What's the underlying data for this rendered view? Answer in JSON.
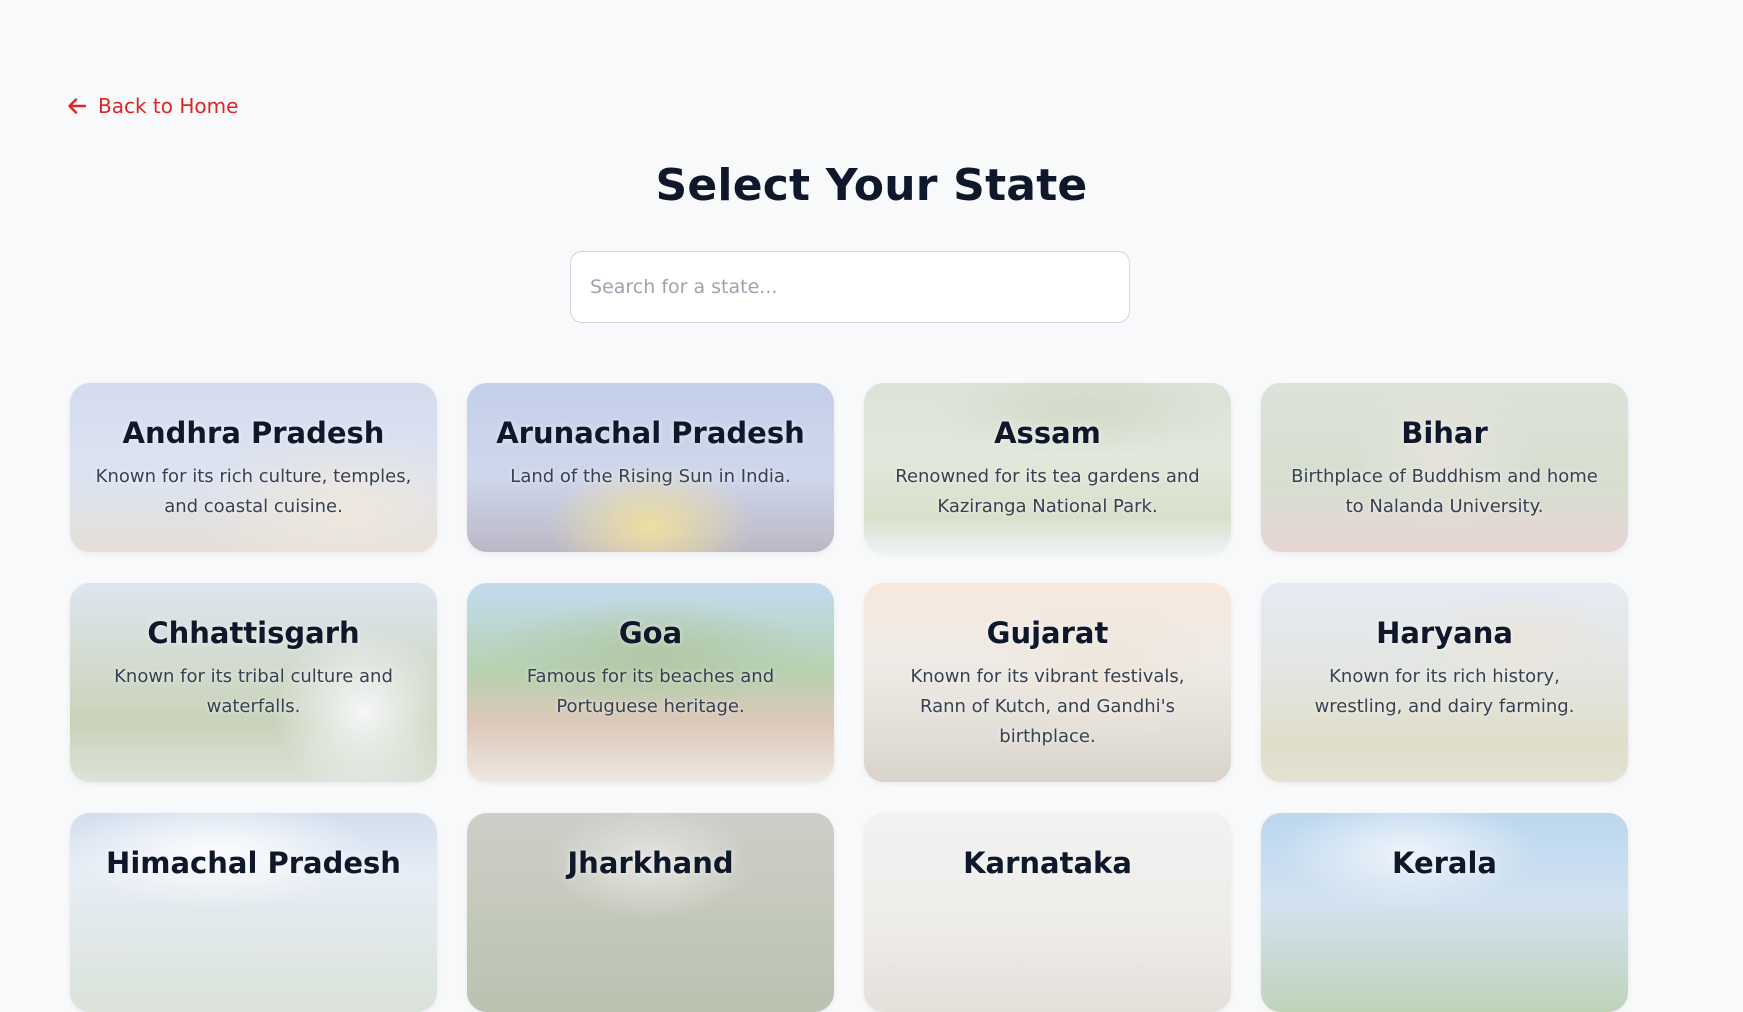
{
  "nav": {
    "back_label": "Back to Home"
  },
  "header": {
    "title": "Select Your State"
  },
  "search": {
    "placeholder": "Search for a state..."
  },
  "colors": {
    "accent": "#dc2626",
    "title": "#0f172a",
    "background": "#f8f9fb"
  },
  "states": [
    {
      "name": "Andhra Pradesh",
      "description": "Known for its rich culture, temples, and coastal cuisine."
    },
    {
      "name": "Arunachal Pradesh",
      "description": "Land of the Rising Sun in India."
    },
    {
      "name": "Assam",
      "description": "Renowned for its tea gardens and Kaziranga National Park."
    },
    {
      "name": "Bihar",
      "description": "Birthplace of Buddhism and home to Nalanda University."
    },
    {
      "name": "Chhattisgarh",
      "description": "Known for its tribal culture and waterfalls."
    },
    {
      "name": "Goa",
      "description": "Famous for its beaches and Portuguese heritage."
    },
    {
      "name": "Gujarat",
      "description": "Known for its vibrant festivals, Rann of Kutch, and Gandhi's birthplace."
    },
    {
      "name": "Haryana",
      "description": "Known for its rich history, wrestling, and dairy farming."
    },
    {
      "name": "Himachal Pradesh",
      "description": ""
    },
    {
      "name": "Jharkhand",
      "description": ""
    },
    {
      "name": "Karnataka",
      "description": ""
    },
    {
      "name": "Kerala",
      "description": ""
    }
  ]
}
